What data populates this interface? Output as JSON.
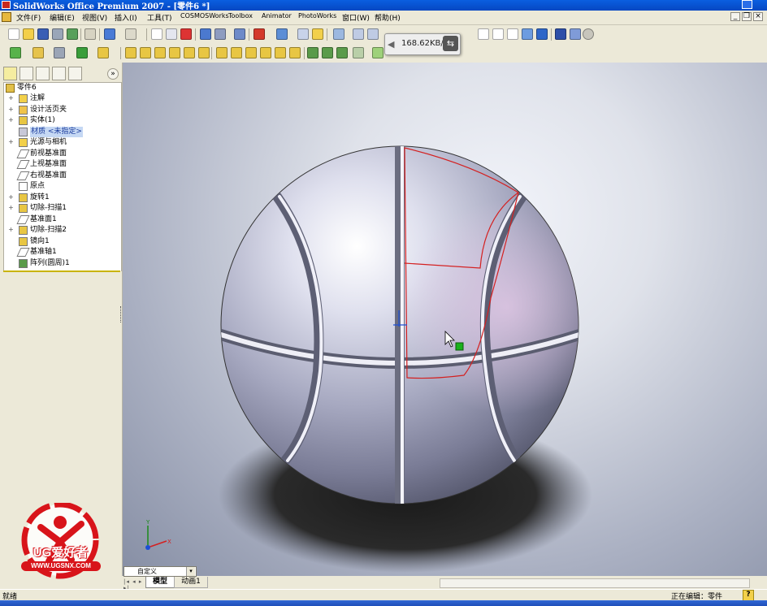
{
  "window": {
    "title": "SolidWorks Office Premium 2007 - [零件6 *]"
  },
  "menu": {
    "items": [
      "文件(F)",
      "编辑(E)",
      "视图(V)",
      "插入(I)",
      "工具(T)",
      "COSMOSWorks",
      "Toolbox",
      "Animator",
      "PhotoWorks",
      "窗口(W)",
      "帮助(H)"
    ]
  },
  "toolbar": {
    "network_speed": "168.62KB/S"
  },
  "feature_tree": {
    "root": "零件6",
    "items": [
      {
        "label": "注解",
        "icon": "annotation-icon",
        "expandable": true
      },
      {
        "label": "设计活页夹",
        "icon": "design-binder-icon",
        "expandable": true
      },
      {
        "label": "实体(1)",
        "icon": "solid-body-icon",
        "expandable": true
      },
      {
        "label": "材质 <未指定>",
        "icon": "material-icon",
        "expandable": false,
        "highlight": true
      },
      {
        "label": "光源与相机",
        "icon": "lights-cameras-icon",
        "expandable": true
      },
      {
        "label": "前视基准面",
        "icon": "plane-icon",
        "expandable": false
      },
      {
        "label": "上视基准面",
        "icon": "plane-icon",
        "expandable": false
      },
      {
        "label": "右视基准面",
        "icon": "plane-icon",
        "expandable": false
      },
      {
        "label": "原点",
        "icon": "origin-icon",
        "expandable": false
      },
      {
        "label": "旋转1",
        "icon": "revolve-icon",
        "expandable": true
      },
      {
        "label": "切除-扫描1",
        "icon": "sweep-cut-icon",
        "expandable": true
      },
      {
        "label": "基准面1",
        "icon": "plane-icon",
        "expandable": false
      },
      {
        "label": "切除-扫描2",
        "icon": "sweep-cut-icon",
        "expandable": true
      },
      {
        "label": "镜向1",
        "icon": "mirror-icon",
        "expandable": false
      },
      {
        "label": "基准轴1",
        "icon": "axis-icon",
        "expandable": false
      },
      {
        "label": "阵列(圆周)1",
        "icon": "circular-pattern-icon",
        "expandable": false
      }
    ]
  },
  "view_selector": {
    "value": "自定义"
  },
  "bottom_tabs": [
    "模型",
    "动画1"
  ],
  "status": {
    "left": "就绪",
    "right": "正在编辑：零件",
    "help": "?"
  },
  "watermark": {
    "brand": "UG爱好者",
    "url": "WWW.UGSNX.COM"
  },
  "colors": {
    "titlebar": "#0647c2",
    "chrome": "#ece9d8",
    "sketch_red": "#d42020",
    "watermark_red": "#d8141a",
    "selection_green": "#19b21b"
  }
}
